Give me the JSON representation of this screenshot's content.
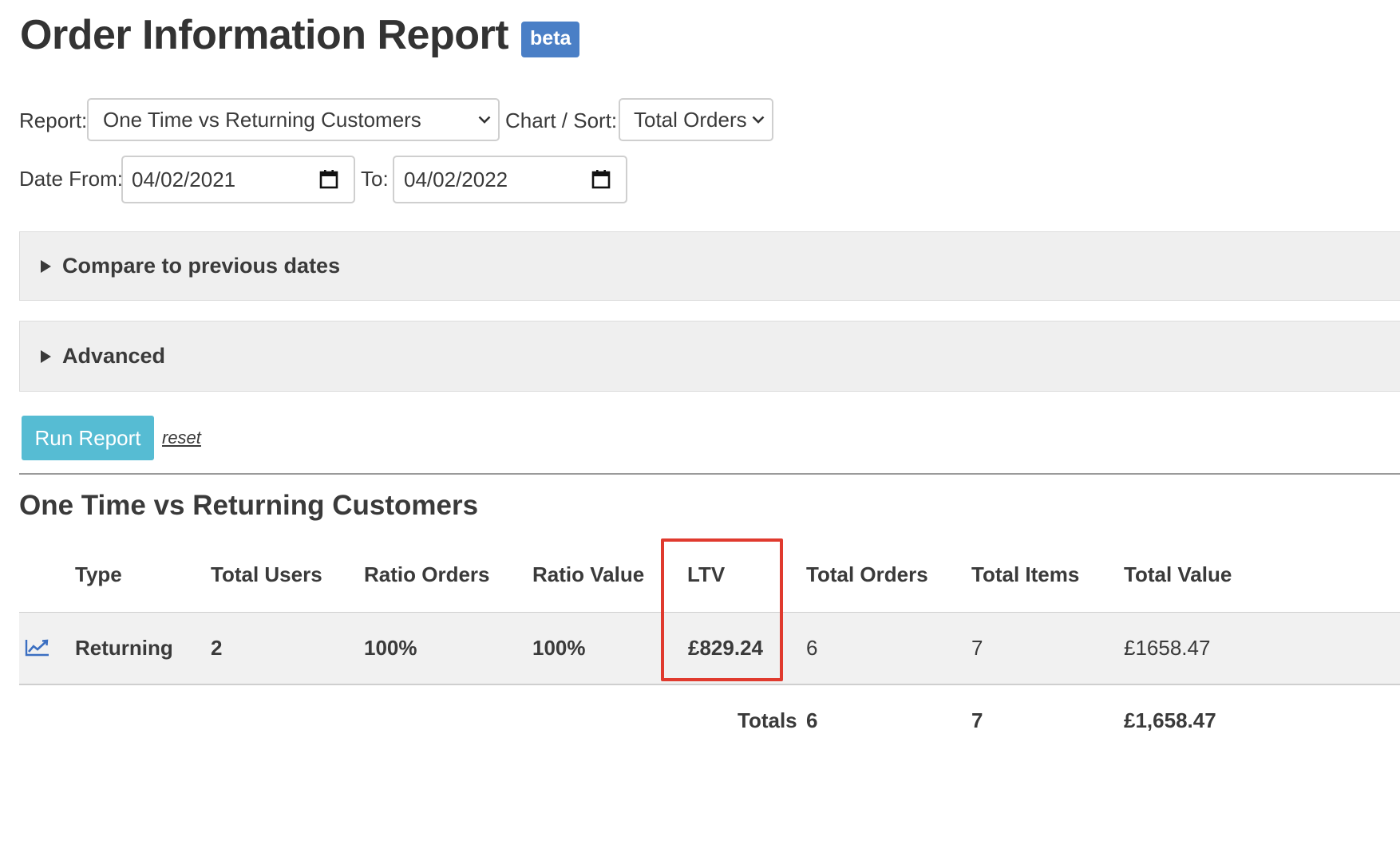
{
  "header": {
    "title": "Order Information Report",
    "badge": "beta"
  },
  "form": {
    "report_label": "Report:",
    "report_value": "One Time vs Returning Customers",
    "sort_label": "Chart / Sort:",
    "sort_value": "Total Orders",
    "date_from_label": "Date From:",
    "date_from_value": "04/02/2021",
    "to_label": "To:",
    "date_to_value": "04/02/2022"
  },
  "panels": {
    "compare": "Compare to previous dates",
    "advanced": "Advanced"
  },
  "actions": {
    "run_label": "Run Report",
    "reset_label": "reset"
  },
  "results": {
    "title": "One Time vs Returning Customers",
    "columns": [
      "Type",
      "Total Users",
      "Ratio Orders",
      "Ratio Value",
      "LTV",
      "Total Orders",
      "Total Items",
      "Total Value"
    ],
    "rows": [
      {
        "icon": "line-chart-icon",
        "type": "Returning",
        "total_users": "2",
        "ratio_orders": "100%",
        "ratio_value": "100%",
        "ltv": "£829.24",
        "total_orders": "6",
        "total_items": "7",
        "total_value": "£1658.47"
      }
    ],
    "totals": {
      "label": "Totals",
      "total_orders": "6",
      "total_items": "7",
      "total_value": "£1,658.47"
    }
  },
  "colors": {
    "badge": "#4a7fc6",
    "run_button": "#56bcd3",
    "highlight": "#e03a2e",
    "chart_icon": "#3b6fc1"
  }
}
